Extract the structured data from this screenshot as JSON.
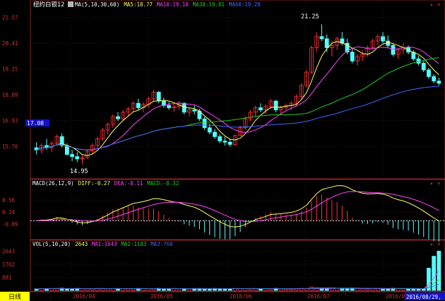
{
  "chart_data": [
    {
      "type": "candlestick",
      "title": "纽约白银12",
      "legend": [
        {
          "label": "MA(5,10,30,60)",
          "color": "#ffffff"
        },
        {
          "label": "MA5:18.77",
          "color": "#ffff66"
        },
        {
          "label": "MA10:19.10",
          "color": "#ff44ff"
        },
        {
          "label": "MA30:19.81",
          "color": "#22cc22"
        },
        {
          "label": "MA60:19.28",
          "color": "#4466ff"
        }
      ],
      "y_ticks": [
        "21.57",
        "20.41",
        "19.25",
        "18.09",
        "16.93",
        "15.76"
      ],
      "ylim": [
        14.4,
        21.9
      ],
      "current_price_tag": "17.08",
      "annotations": [
        {
          "text": "21.25",
          "x": "2016/07 (early)",
          "y": 21.25
        },
        {
          "text": "14.95",
          "x": "2016/04 (mid)",
          "y": 14.95
        }
      ],
      "x_ticks": [
        "2016/04",
        "2016/05",
        "2016/06",
        "2016/07",
        "2016/08"
      ],
      "candles_ohlc_approx": [
        [
          15.7,
          15.95,
          15.4,
          15.6
        ],
        [
          15.6,
          15.9,
          15.45,
          15.8
        ],
        [
          15.8,
          16.1,
          15.6,
          15.7
        ],
        [
          15.7,
          16.0,
          15.5,
          15.9
        ],
        [
          15.9,
          16.3,
          15.8,
          16.2
        ],
        [
          16.2,
          16.35,
          15.7,
          15.8
        ],
        [
          15.8,
          15.9,
          15.35,
          15.4
        ],
        [
          15.4,
          15.6,
          15.1,
          15.3
        ],
        [
          15.3,
          15.5,
          15.05,
          15.2
        ],
        [
          15.2,
          15.4,
          14.95,
          15.25
        ],
        [
          15.25,
          15.6,
          15.2,
          15.55
        ],
        [
          15.55,
          15.9,
          15.4,
          15.8
        ],
        [
          15.8,
          16.2,
          15.7,
          16.1
        ],
        [
          16.1,
          16.6,
          16.0,
          16.5
        ],
        [
          16.5,
          16.85,
          16.3,
          16.75
        ],
        [
          16.75,
          17.2,
          16.6,
          17.1
        ],
        [
          17.1,
          17.3,
          16.9,
          17.0
        ],
        [
          17.0,
          17.4,
          16.9,
          17.3
        ],
        [
          17.3,
          17.55,
          17.1,
          17.45
        ],
        [
          17.45,
          17.8,
          17.3,
          17.7
        ],
        [
          17.7,
          17.9,
          17.4,
          17.5
        ],
        [
          17.5,
          17.75,
          17.3,
          17.65
        ],
        [
          17.65,
          18.0,
          17.5,
          17.9
        ],
        [
          17.9,
          18.3,
          17.8,
          18.2
        ],
        [
          18.2,
          18.25,
          17.7,
          17.8
        ],
        [
          17.8,
          17.95,
          17.5,
          17.6
        ],
        [
          17.6,
          17.75,
          17.4,
          17.5
        ],
        [
          17.5,
          17.7,
          17.3,
          17.55
        ],
        [
          17.55,
          17.8,
          17.4,
          17.7
        ],
        [
          17.7,
          17.75,
          17.2,
          17.3
        ],
        [
          17.3,
          17.5,
          17.1,
          17.4
        ],
        [
          17.4,
          17.6,
          17.2,
          17.35
        ],
        [
          17.35,
          17.45,
          16.9,
          17.0
        ],
        [
          17.0,
          17.1,
          16.5,
          16.6
        ],
        [
          16.6,
          16.8,
          16.3,
          16.4
        ],
        [
          16.4,
          16.55,
          16.1,
          16.2
        ],
        [
          16.2,
          16.3,
          15.9,
          16.0
        ],
        [
          16.0,
          16.2,
          15.8,
          15.95
        ],
        [
          15.95,
          16.1,
          15.75,
          15.85
        ],
        [
          15.85,
          16.3,
          15.8,
          16.25
        ],
        [
          16.25,
          16.7,
          16.2,
          16.6
        ],
        [
          16.6,
          17.1,
          16.5,
          17.0
        ],
        [
          17.0,
          17.4,
          16.9,
          17.3
        ],
        [
          17.3,
          17.6,
          17.1,
          17.5
        ],
        [
          17.5,
          17.7,
          17.3,
          17.4
        ],
        [
          17.4,
          17.65,
          17.2,
          17.55
        ],
        [
          17.55,
          17.9,
          17.45,
          17.8
        ],
        [
          17.8,
          17.85,
          17.3,
          17.4
        ],
        [
          17.4,
          17.6,
          17.2,
          17.5
        ],
        [
          17.5,
          17.7,
          17.35,
          17.6
        ],
        [
          17.6,
          17.8,
          17.4,
          17.7
        ],
        [
          17.7,
          18.1,
          17.6,
          18.0
        ],
        [
          18.0,
          18.6,
          17.9,
          18.5
        ],
        [
          18.5,
          19.2,
          18.4,
          19.1
        ],
        [
          19.1,
          20.3,
          19.0,
          20.2
        ],
        [
          20.2,
          20.9,
          20.0,
          20.7
        ],
        [
          20.7,
          21.25,
          20.5,
          20.6
        ],
        [
          20.6,
          20.8,
          20.0,
          20.2
        ],
        [
          20.2,
          20.5,
          19.8,
          20.3
        ],
        [
          20.3,
          20.7,
          20.1,
          20.6
        ],
        [
          20.6,
          20.9,
          20.3,
          20.4
        ],
        [
          20.4,
          20.6,
          19.9,
          20.0
        ],
        [
          20.0,
          20.2,
          19.5,
          19.6
        ],
        [
          19.6,
          19.9,
          19.4,
          19.8
        ],
        [
          19.8,
          20.1,
          19.6,
          19.9
        ],
        [
          19.9,
          20.3,
          19.8,
          20.2
        ],
        [
          20.2,
          20.6,
          20.1,
          20.5
        ],
        [
          20.5,
          20.8,
          20.3,
          20.7
        ],
        [
          20.7,
          20.9,
          20.4,
          20.5
        ],
        [
          20.5,
          20.75,
          20.2,
          20.3
        ],
        [
          20.3,
          20.4,
          19.8,
          19.9
        ],
        [
          19.9,
          20.2,
          19.7,
          20.1
        ],
        [
          20.1,
          20.4,
          19.9,
          20.2
        ],
        [
          20.2,
          20.3,
          19.9,
          20.0
        ],
        [
          20.0,
          20.1,
          19.6,
          19.7
        ],
        [
          19.7,
          19.85,
          19.4,
          19.5
        ],
        [
          19.5,
          19.6,
          19.1,
          19.2
        ],
        [
          19.2,
          19.3,
          18.8,
          18.9
        ],
        [
          18.9,
          19.0,
          18.6,
          18.7
        ],
        [
          18.7,
          18.85,
          18.5,
          18.6
        ]
      ]
    },
    {
      "type": "macd",
      "legend": [
        {
          "label": "MACD(26,12,9)",
          "color": "#ffffff"
        },
        {
          "label": "DIFF:-0.27",
          "color": "#ffff66"
        },
        {
          "label": "DEA:-0.11",
          "color": "#ff44ff"
        },
        {
          "label": "MACD:-0.32",
          "color": "#22cc22"
        }
      ],
      "y_ticks": [
        "0.56",
        "0.24",
        "-0.09"
      ],
      "ylim": [
        -0.45,
        0.85
      ]
    },
    {
      "type": "volume",
      "legend": [
        {
          "label": "VOL(5,10,20)",
          "color": "#ffffff"
        },
        {
          "label": "2643",
          "color": "#ffff66"
        },
        {
          "label": "MA1:1643",
          "color": "#ff44ff"
        },
        {
          "label": "MA2:1183",
          "color": "#22cc22"
        },
        {
          "label": "MA3:768",
          "color": "#4466ff"
        }
      ],
      "y_ticks": [
        "2643",
        "1762",
        "881"
      ],
      "ylim": [
        0,
        2800
      ]
    }
  ],
  "period_tab": "日线",
  "date_badge": "2016/08/29, -"
}
